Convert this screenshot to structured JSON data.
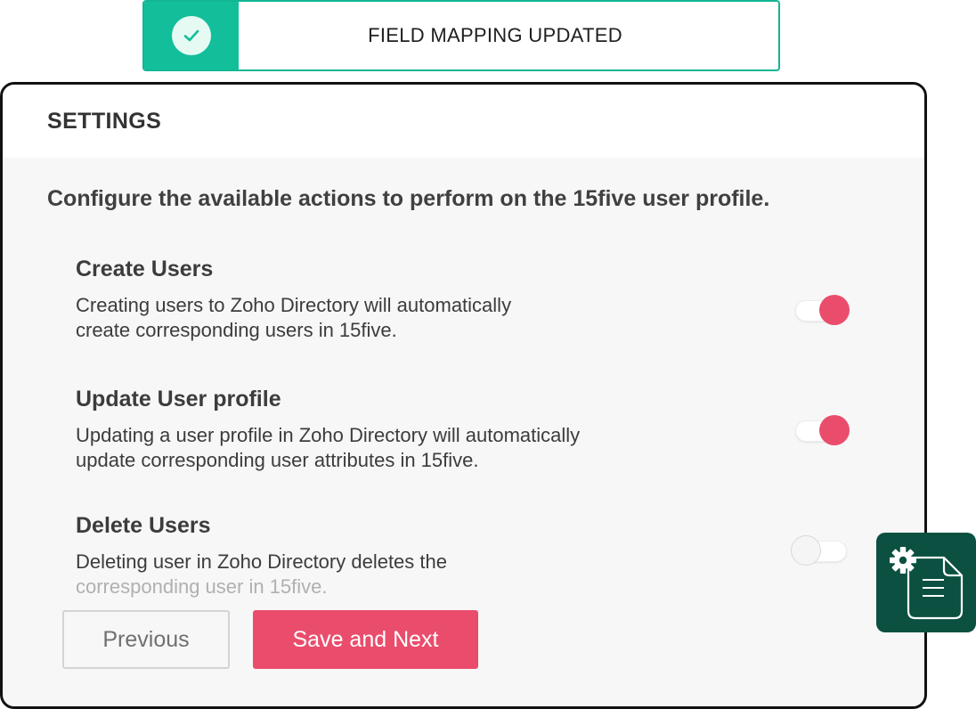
{
  "toast": {
    "message": "FIELD MAPPING UPDATED",
    "icon": "check-icon",
    "accent_color": "#12bf9a"
  },
  "panel": {
    "title": "SETTINGS",
    "intro": "Configure the available actions to perform on the 15five user profile."
  },
  "settings": [
    {
      "title": "Create Users",
      "desc_line1": "Creating users to Zoho Directory will automatically",
      "desc_line2": "create corresponding users in 15five.",
      "enabled": true
    },
    {
      "title": "Update User profile",
      "desc_line1": "Updating a user profile in Zoho Directory will automatically",
      "desc_line2": "update corresponding user attributes in 15five.",
      "enabled": true
    },
    {
      "title": "Delete Users",
      "desc_line1": "Deleting user in Zoho Directory deletes the",
      "desc_line2": "corresponding user in 15five.",
      "enabled": false
    }
  ],
  "buttons": {
    "previous": "Previous",
    "save_next": "Save and Next"
  },
  "widget": {
    "icons": [
      "gear-icon",
      "document-icon"
    ],
    "color": "#0b5040"
  },
  "colors": {
    "primary": "#ea4d6c",
    "success": "#12bf9a"
  }
}
